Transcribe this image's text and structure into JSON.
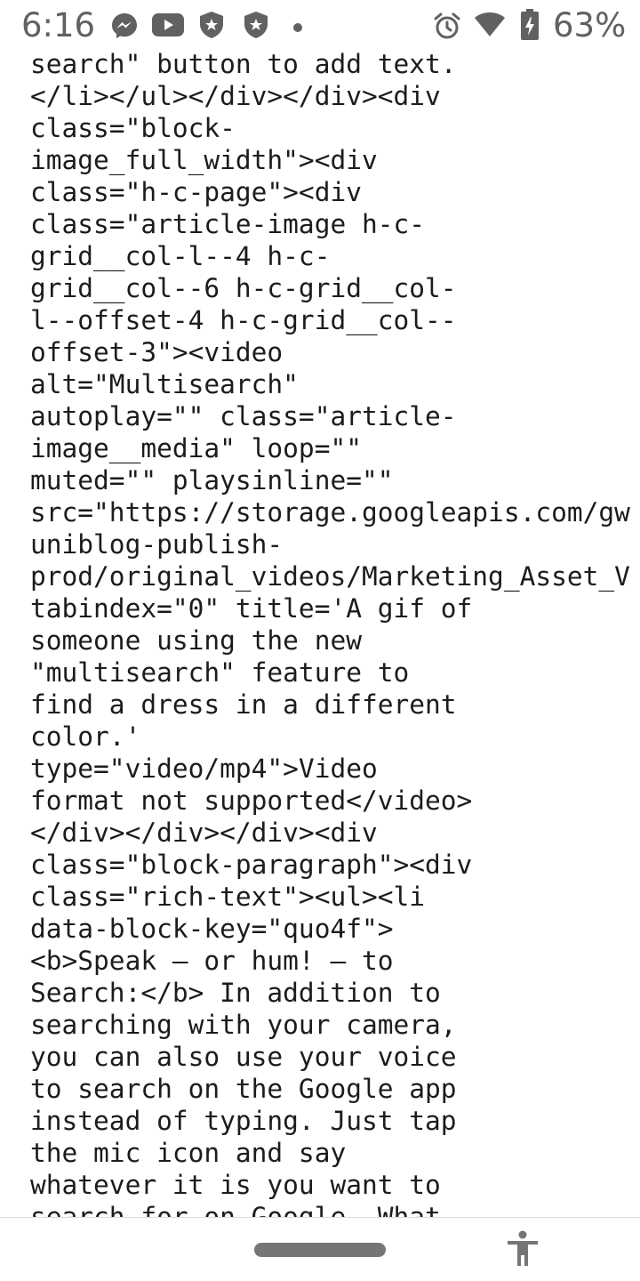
{
  "status_bar": {
    "time": "6:16",
    "battery_percent": "63%",
    "icons": [
      "messenger-icon",
      "youtube-icon",
      "shield-icon",
      "shield-icon",
      "dot-icon",
      "alarm-icon",
      "wifi-icon",
      "battery-icon"
    ],
    "icon_color": "#616161"
  },
  "content": {
    "lines": [
      "search\" button to add text.",
      "</li></ul></div></div><div",
      "class=\"block-",
      "image_full_width\"><div",
      "class=\"h-c-page\"><div",
      "class=\"article-image h-c-",
      "grid__col-l--4 h-c-",
      "grid__col--6 h-c-grid__col-",
      "l--offset-4 h-c-grid__col--",
      "offset-3\"><video",
      "alt=\"Multisearch\"",
      "autoplay=\"\" class=\"article-",
      "image__media\" loop=\"\"",
      "muted=\"\" playsinline=\"\"",
      "src=\"https://storage.googleapis.com/gw",
      "uniblog-publish-",
      "prod/original_videos/Marketing_Asset_V",
      "tabindex=\"0\" title='A gif of",
      "someone using the new",
      "\"multisearch\" feature to",
      "find a dress in a different",
      "color.'",
      "type=\"video/mp4\">Video",
      "format not supported</video>",
      "</div></div></div><div",
      "class=\"block-paragraph\"><div",
      "class=\"rich-text\"><ul><li",
      "data-block-key=\"quo4f\">",
      "<b>Speak – or hum! – to",
      "Search:</b> In addition to",
      "searching with your camera,",
      "you can also use your voice",
      "to search on the Google app",
      "instead of typing. Just tap",
      "the mic icon and say",
      "whatever it is you want to",
      "search for on Google. What"
    ]
  },
  "nav_bar": {
    "icons": [
      "home-pill",
      "accessibility-icon"
    ]
  }
}
